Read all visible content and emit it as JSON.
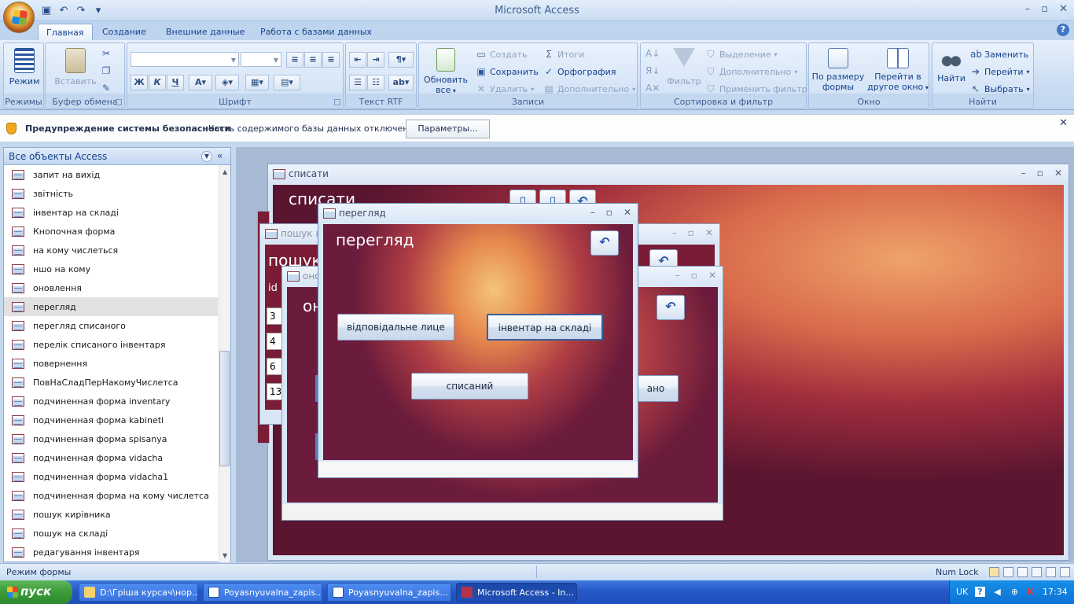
{
  "app": {
    "title": "Microsoft Access",
    "window_controls": [
      "–",
      "▫",
      "✕"
    ]
  },
  "tabs": [
    "Главная",
    "Создание",
    "Внешние данные",
    "Работа с базами данных"
  ],
  "ribbon": {
    "groups": {
      "views": "Режимы",
      "clipboard": "Буфер обмена",
      "font": "Шрифт",
      "rtf": "Текст RTF",
      "records": "Записи",
      "sort": "Сортировка и фильтр",
      "window": "Окно",
      "find": "Найти"
    },
    "view_btn": "Режим",
    "paste_btn": "Вставить",
    "refresh_btn_1": "Обновить",
    "refresh_btn_2": "все",
    "create": "Создать",
    "save": "Сохранить",
    "delete": "Удалить",
    "totals": "Итоги",
    "spelling": "Орфография",
    "more": "Дополнительно",
    "filter_btn": "Фильтр",
    "selection": "Выделение",
    "advanced": "Дополнительно",
    "toggle_filter": "Применить фильтр",
    "fit_form_1": "По размеру",
    "fit_form_2": "формы",
    "switch_win_1": "Перейти в",
    "switch_win_2": "другое окно",
    "find_btn": "Найти",
    "replace": "Заменить",
    "goto": "Перейти",
    "select": "Выбрать"
  },
  "security": {
    "title": "Предупреждение системы безопасности",
    "message": "Часть содержимого базы данных отключено",
    "button": "Параметры..."
  },
  "nav": {
    "title": "Все объекты Access",
    "items": [
      "запит на вихід",
      "звітність",
      "інвентар на складі",
      "Кнопочная форма",
      "на кому числеться",
      "ншо на кому",
      "оновлення",
      "перегляд",
      "перегляд списаного",
      "перелік списаного інвентаря",
      "повернення",
      "ПовНаСладПерНакомуЧислетса",
      "подчиненная форма inventary",
      "подчиненная форма kabineti",
      "подчиненная форма spisanya",
      "подчиненная форма vidacha",
      "подчиненная форма vidacha1",
      "подчиненная форма на кому числетса",
      "пошук кирівника",
      "пошук на складі",
      "редагування інвентаря"
    ],
    "selected_index": 7
  },
  "windows": {
    "spysaty": {
      "title": "списати",
      "form_title": "списати"
    },
    "poshuk": {
      "title": "пошук н",
      "form_title": "пошук",
      "col": "id",
      "rows": [
        "3",
        "4",
        "6",
        "13"
      ]
    },
    "onovlennya": {
      "title": "оно",
      "form_title": "он",
      "btn_partial": "ано"
    },
    "perehlyad": {
      "title": "перегляд",
      "form_title": "перегляд",
      "btn_responsible": "відповідальне лице",
      "btn_warehouse": "інвентар на складі",
      "btn_written_off": "списаний"
    }
  },
  "status": {
    "mode": "Режим формы",
    "numlock": "Num Lock"
  },
  "taskbar": {
    "start": "пуск",
    "tasks": [
      "D:\\Гріша курсач\\нор...",
      "Poyasnyuvalna_zapis...",
      "Poyasnyuvalna_zapis...",
      "Microsoft Access - In..."
    ],
    "lang": "UK",
    "clock": "17:34"
  }
}
